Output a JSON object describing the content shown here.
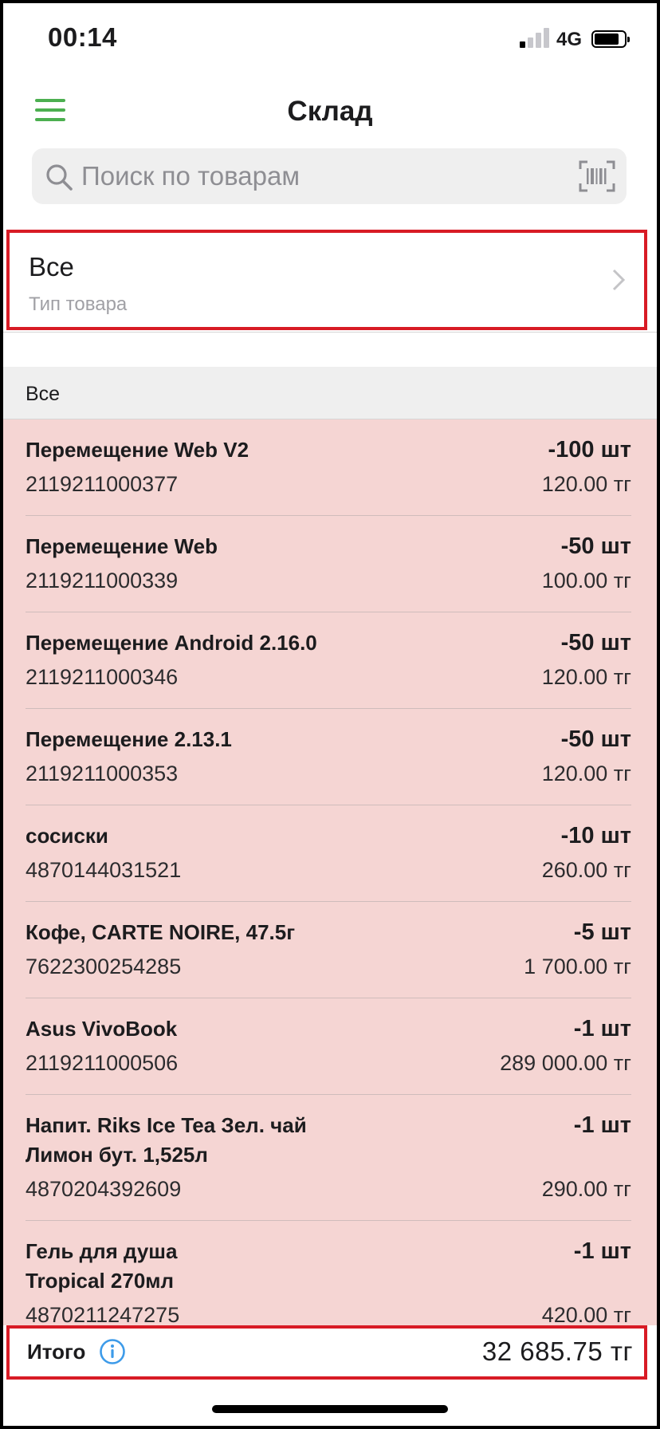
{
  "status_bar": {
    "time": "00:14",
    "network": "4G"
  },
  "nav": {
    "title": "Склад"
  },
  "search": {
    "placeholder": "Поиск по товарам"
  },
  "filter": {
    "value": "Все",
    "caption": "Тип товара"
  },
  "section": {
    "title": "Все"
  },
  "products": [
    {
      "name": "Перемещение Web  V2",
      "code": "2119211000377",
      "qty": "-100 шт",
      "price": "120.00 тг"
    },
    {
      "name": "Перемещение Web",
      "code": "2119211000339",
      "qty": "-50 шт",
      "price": "100.00 тг"
    },
    {
      "name": "Перемещение Android 2.16.0",
      "code": "2119211000346",
      "qty": "-50 шт",
      "price": "120.00 тг"
    },
    {
      "name": "Перемещение 2.13.1",
      "code": "2119211000353",
      "qty": "-50 шт",
      "price": "120.00 тг"
    },
    {
      "name": "сосиски",
      "code": "4870144031521",
      "qty": "-10 шт",
      "price": "260.00 тг"
    },
    {
      "name": "Кофе, CARTE NOIRE, 47.5г",
      "code": "7622300254285",
      "qty": "-5 шт",
      "price": "1 700.00 тг"
    },
    {
      "name": "Asus VivoBook",
      "code": "2119211000506",
      "qty": "-1 шт",
      "price": "289 000.00 тг"
    },
    {
      "name": "Напит. Riks Ice Tea Зел. чай\nЛимон бут. 1,525л",
      "code": "4870204392609",
      "qty": "-1 шт",
      "price": "290.00 тг"
    },
    {
      "name": "Гель для душа\nTropical 270мл",
      "code": "4870211247275",
      "qty": "-1 шт",
      "price": "420.00 тг"
    }
  ],
  "total": {
    "label": "Итого",
    "value": "32 685.75 тг"
  },
  "colors": {
    "accent_green": "#4caf50",
    "highlight_red": "#d81b25",
    "negative_row_bg": "#f5d5d3",
    "info_blue": "#3d9be9"
  },
  "icons": [
    "menu-icon",
    "search-icon",
    "barcode-scan-icon",
    "chevron-right-icon",
    "info-icon"
  ]
}
